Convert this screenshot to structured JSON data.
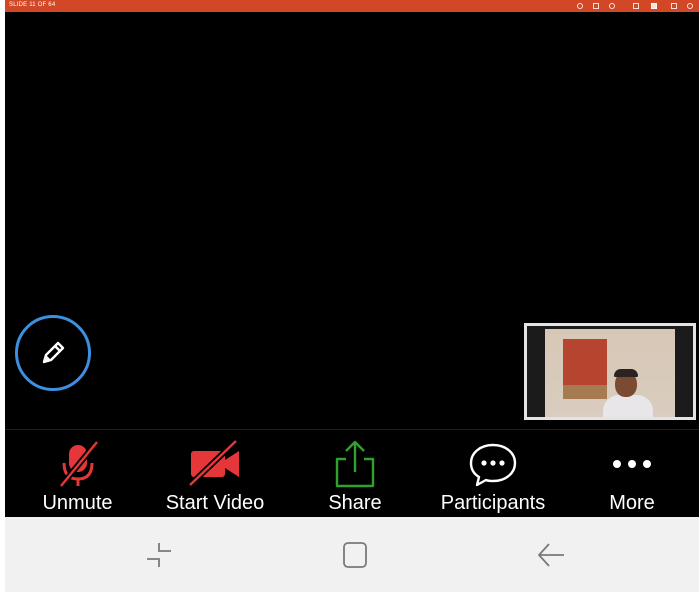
{
  "slide_bar": {
    "counter": "SLIDE 11 OF 64",
    "color": "#d24726"
  },
  "annotate": {
    "icon": "pencil-icon",
    "ring_color": "#3d8fe0"
  },
  "self_view": {
    "description_icon": "camera-self-view"
  },
  "toolbar": {
    "items": [
      {
        "label": "Unmute",
        "icon": "microphone-muted-icon",
        "color": "#e5373a"
      },
      {
        "label": "Start Video",
        "icon": "video-camera-off-icon",
        "color": "#e5373a"
      },
      {
        "label": "Share",
        "icon": "share-upload-icon",
        "color": "#2ea12e"
      },
      {
        "label": "Participants",
        "icon": "chat-bubble-icon",
        "color": "#ffffff"
      },
      {
        "label": "More",
        "icon": "more-dots-icon",
        "color": "#ffffff"
      }
    ]
  },
  "navbar": {
    "buttons": [
      {
        "icon": "recent-apps-icon"
      },
      {
        "icon": "home-icon"
      },
      {
        "icon": "back-icon"
      }
    ],
    "color": "#f1f1f1"
  }
}
